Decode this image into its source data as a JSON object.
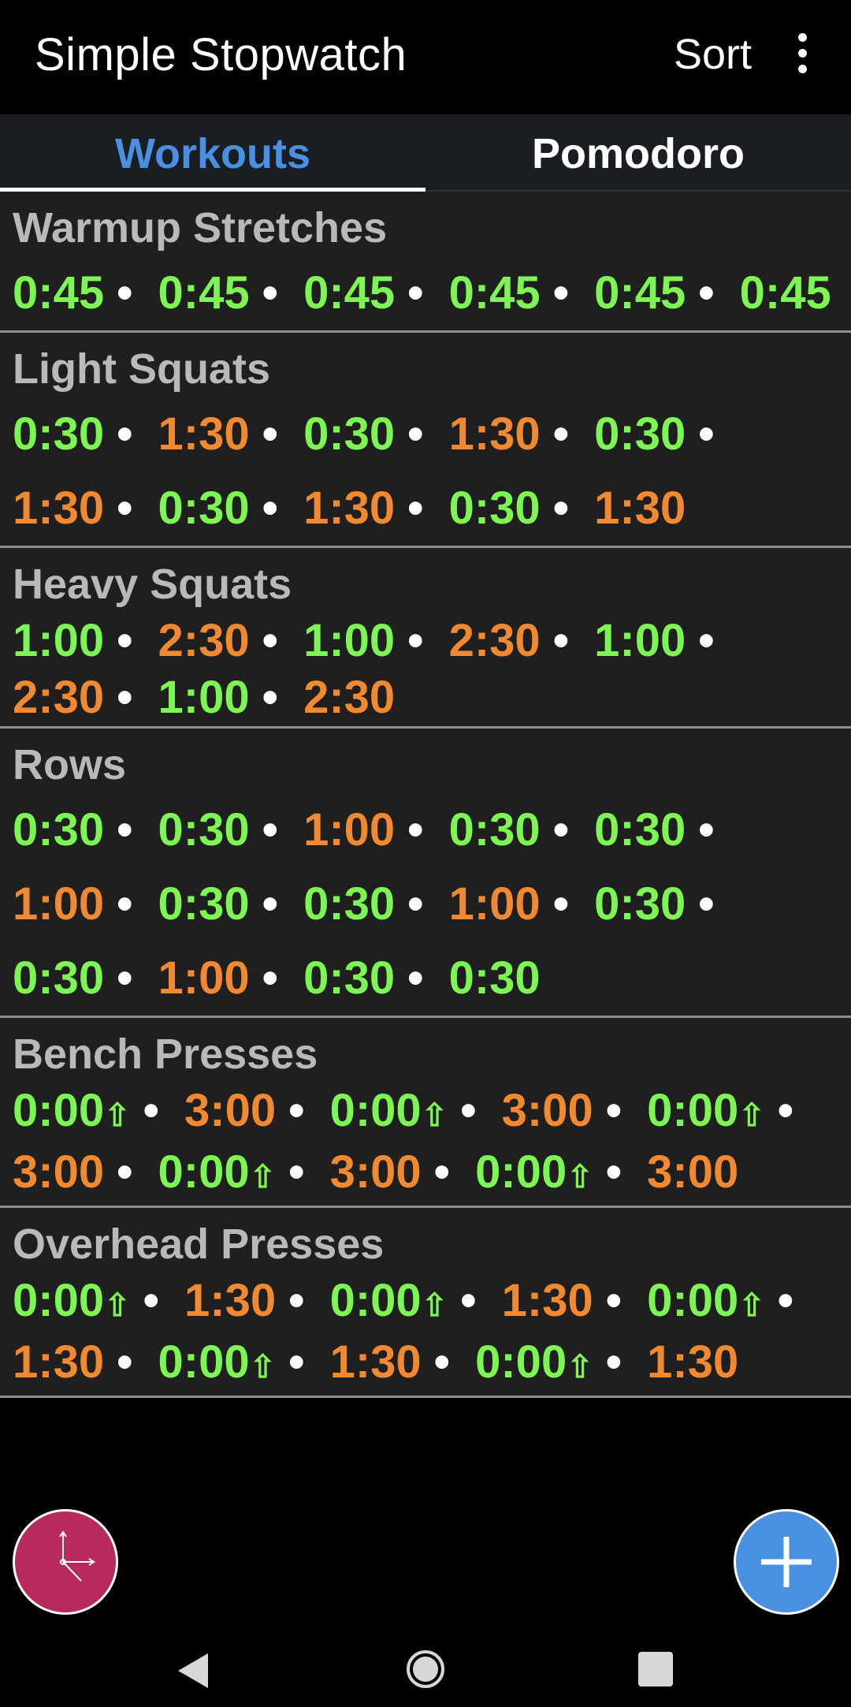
{
  "app_bar": {
    "title": "Simple Stopwatch",
    "sort_label": "Sort",
    "overflow_icon": "more-vert-icon"
  },
  "tabs": [
    {
      "label": "Workouts",
      "active": true
    },
    {
      "label": "Pomodoro",
      "active": false
    }
  ],
  "colors": {
    "work": "#7df552",
    "rest": "#f0892f",
    "tab_active": "#4a90e2",
    "fab_timer": "#b82a5e",
    "fab_add": "#4a90e2"
  },
  "workouts": [
    {
      "name": "Warmup Stretches",
      "times": [
        {
          "value": "0:45",
          "color": "green",
          "count_up": false
        },
        {
          "value": "0:45",
          "color": "green",
          "count_up": false
        },
        {
          "value": "0:45",
          "color": "green",
          "count_up": false
        },
        {
          "value": "0:45",
          "color": "green",
          "count_up": false
        },
        {
          "value": "0:45",
          "color": "green",
          "count_up": false
        },
        {
          "value": "0:45",
          "color": "green",
          "count_up": false
        }
      ],
      "spacing": "normal"
    },
    {
      "name": "Light Squats",
      "times": [
        {
          "value": "0:30",
          "color": "green",
          "count_up": false
        },
        {
          "value": "1:30",
          "color": "orange",
          "count_up": false
        },
        {
          "value": "0:30",
          "color": "green",
          "count_up": false
        },
        {
          "value": "1:30",
          "color": "orange",
          "count_up": false
        },
        {
          "value": "0:30",
          "color": "green",
          "count_up": false
        },
        {
          "value": "1:30",
          "color": "orange",
          "count_up": false
        },
        {
          "value": "0:30",
          "color": "green",
          "count_up": false
        },
        {
          "value": "1:30",
          "color": "orange",
          "count_up": false
        },
        {
          "value": "0:30",
          "color": "green",
          "count_up": false
        },
        {
          "value": "1:30",
          "color": "orange",
          "count_up": false
        }
      ],
      "spacing": "normal"
    },
    {
      "name": "Heavy Squats",
      "times": [
        {
          "value": "1:00",
          "color": "green",
          "count_up": false
        },
        {
          "value": "2:30",
          "color": "orange",
          "count_up": false
        },
        {
          "value": "1:00",
          "color": "green",
          "count_up": false
        },
        {
          "value": "2:30",
          "color": "orange",
          "count_up": false
        },
        {
          "value": "1:00",
          "color": "green",
          "count_up": false
        },
        {
          "value": "2:30",
          "color": "orange",
          "count_up": false
        },
        {
          "value": "1:00",
          "color": "green",
          "count_up": false
        },
        {
          "value": "2:30",
          "color": "orange",
          "count_up": false
        }
      ],
      "spacing": "tight"
    },
    {
      "name": "Rows",
      "times": [
        {
          "value": "0:30",
          "color": "green",
          "count_up": false
        },
        {
          "value": "0:30",
          "color": "green",
          "count_up": false
        },
        {
          "value": "1:00",
          "color": "orange",
          "count_up": false
        },
        {
          "value": "0:30",
          "color": "green",
          "count_up": false
        },
        {
          "value": "0:30",
          "color": "green",
          "count_up": false
        },
        {
          "value": "1:00",
          "color": "orange",
          "count_up": false
        },
        {
          "value": "0:30",
          "color": "green",
          "count_up": false
        },
        {
          "value": "0:30",
          "color": "green",
          "count_up": false
        },
        {
          "value": "1:00",
          "color": "orange",
          "count_up": false
        },
        {
          "value": "0:30",
          "color": "green",
          "count_up": false
        },
        {
          "value": "0:30",
          "color": "green",
          "count_up": false
        },
        {
          "value": "1:00",
          "color": "orange",
          "count_up": false
        },
        {
          "value": "0:30",
          "color": "green",
          "count_up": false
        },
        {
          "value": "0:30",
          "color": "green",
          "count_up": false
        }
      ],
      "spacing": "normal"
    },
    {
      "name": "Bench Presses",
      "times": [
        {
          "value": "0:00",
          "color": "green",
          "count_up": true
        },
        {
          "value": "3:00",
          "color": "orange",
          "count_up": false
        },
        {
          "value": "0:00",
          "color": "green",
          "count_up": true
        },
        {
          "value": "3:00",
          "color": "orange",
          "count_up": false
        },
        {
          "value": "0:00",
          "color": "green",
          "count_up": true
        },
        {
          "value": "3:00",
          "color": "orange",
          "count_up": false
        },
        {
          "value": "0:00",
          "color": "green",
          "count_up": true
        },
        {
          "value": "3:00",
          "color": "orange",
          "count_up": false
        },
        {
          "value": "0:00",
          "color": "green",
          "count_up": true
        },
        {
          "value": "3:00",
          "color": "orange",
          "count_up": false
        }
      ],
      "spacing": "tight"
    },
    {
      "name": "Overhead Presses",
      "times": [
        {
          "value": "0:00",
          "color": "green",
          "count_up": true
        },
        {
          "value": "1:30",
          "color": "orange",
          "count_up": false
        },
        {
          "value": "0:00",
          "color": "green",
          "count_up": true
        },
        {
          "value": "1:30",
          "color": "orange",
          "count_up": false
        },
        {
          "value": "0:00",
          "color": "green",
          "count_up": true
        },
        {
          "value": "1:30",
          "color": "orange",
          "count_up": false
        },
        {
          "value": "0:00",
          "color": "green",
          "count_up": true
        },
        {
          "value": "1:30",
          "color": "orange",
          "count_up": false
        },
        {
          "value": "0:00",
          "color": "green",
          "count_up": true
        },
        {
          "value": "1:30",
          "color": "orange",
          "count_up": false
        }
      ],
      "spacing": "tight"
    }
  ],
  "count_up_symbol": "⇧",
  "separator": "•",
  "fabs": {
    "left_icon": "clock-icon",
    "right_icon": "add-icon"
  },
  "system_nav": {
    "back_icon": "back-icon",
    "home_icon": "home-icon",
    "recents_icon": "recents-icon"
  }
}
